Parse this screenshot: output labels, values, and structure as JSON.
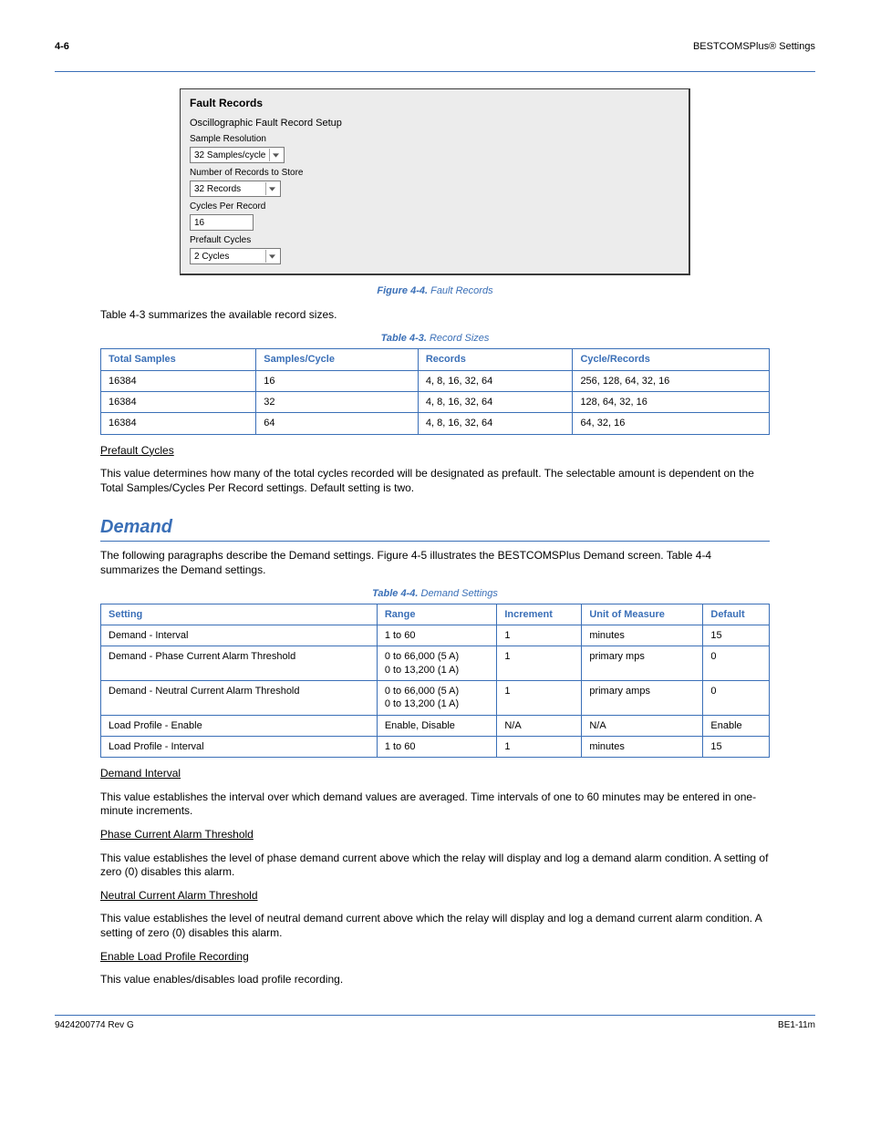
{
  "header": {
    "page_number": "4-6",
    "chapter_title": "BESTCOMSPlus® Settings"
  },
  "screenshot": {
    "panel_title": "Fault Records",
    "subtitle": "Oscillographic Fault Record Setup",
    "fields": {
      "sample_res_label": "Sample Resolution",
      "sample_res_value": "32 Samples/cycle",
      "num_records_label": "Number of Records to Store",
      "num_records_value": "32 Records",
      "cycles_per_record_label": "Cycles Per Record",
      "cycles_per_record_value": "16",
      "prefault_label": "Prefault Cycles",
      "prefault_value": "2 Cycles"
    }
  },
  "figure_caption": {
    "num": "Figure 4-4.",
    "text": "Fault Records"
  },
  "para_table3_intro": "Table 4-3 summarizes the available record sizes.",
  "table3": {
    "caption_num": "Table 4-3.",
    "caption_text": "Record Sizes",
    "headers": [
      "Total Samples",
      "Samples/Cycle",
      "Records",
      "Cycle/Records"
    ],
    "rows": [
      [
        "16384",
        "16",
        "4, 8, 16, 32, 64",
        "256, 128, 64, 32, 16"
      ],
      [
        "16384",
        "32",
        "4, 8, 16, 32, 64",
        "128, 64, 32, 16"
      ],
      [
        "16384",
        "64",
        "4, 8, 16, 32, 64",
        "64, 32, 16"
      ]
    ]
  },
  "prefault_section": {
    "heading": "Prefault Cycles",
    "body": "This value determines how many of the total cycles recorded will be designated as prefault. The selectable amount is dependent on the Total Samples/Cycles Per Record settings. Default setting is two."
  },
  "demand_section": {
    "heading": "Demand",
    "intro": "The following paragraphs describe the Demand settings. Figure 4-5 illustrates the BESTCOMSPlus Demand screen. Table 4-4 summarizes the Demand settings.",
    "table4": {
      "caption_num": "Table 4-4.",
      "caption_text": "Demand Settings",
      "headers": [
        "Setting",
        "Range",
        "Increment",
        "Unit of Measure",
        "Default"
      ],
      "rows": [
        [
          "Demand - Interval",
          "1 to 60",
          "1",
          "minutes",
          "15"
        ],
        [
          "Demand - Phase Current Alarm Threshold",
          "0 to 66,000 (5 A)\n0 to 13,200 (1 A)",
          "1",
          "primary mps",
          "0"
        ],
        [
          "Demand - Neutral Current Alarm Threshold",
          "0 to 66,000 (5 A)\n0 to 13,200 (1 A)",
          "1",
          "primary amps",
          "0"
        ],
        [
          "Load Profile - Enable",
          "Enable, Disable",
          "N/A",
          "N/A",
          "Enable"
        ],
        [
          "Load Profile - Interval",
          "1 to 60",
          "1",
          "minutes",
          "15"
        ]
      ]
    },
    "interval": {
      "heading": "Demand Interval",
      "body": "This value establishes the interval over which demand values are averaged. Time intervals of one to 60 minutes may be entered in one-minute increments."
    },
    "phase_alarm": {
      "heading": "Phase Current Alarm Threshold",
      "body": "This value establishes the level of phase demand current above which the relay will display and log a demand alarm condition. A setting of zero (0) disables this alarm."
    },
    "neutral_alarm": {
      "heading": "Neutral Current Alarm Threshold",
      "body": "This value establishes the level of neutral demand current above which the relay will display and log a demand current alarm condition. A setting of zero (0) disables this alarm."
    },
    "load_profile": {
      "heading": "Enable Load Profile Recording",
      "body": "This value enables/disables load profile recording."
    }
  },
  "footer": {
    "left": "9424200774 Rev G",
    "right": "BE1-11m"
  }
}
